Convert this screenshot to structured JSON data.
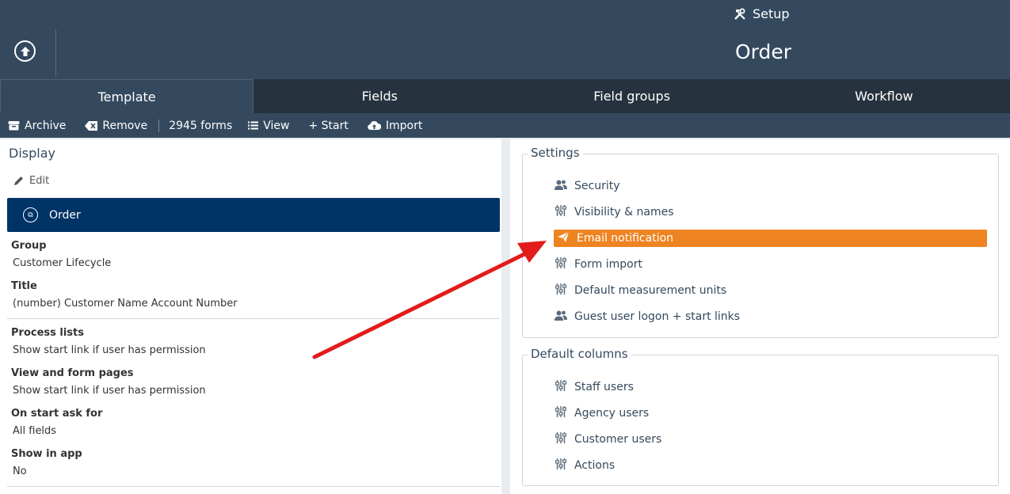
{
  "header": {
    "setup_label": "Setup",
    "page_title": "Order"
  },
  "tabs": [
    {
      "label": "Template"
    },
    {
      "label": "Fields"
    },
    {
      "label": "Field groups"
    },
    {
      "label": "Workflow"
    }
  ],
  "toolbar": {
    "archive": "Archive",
    "remove": "Remove",
    "forms_count": "2945 forms",
    "view": "View",
    "start": "+ Start",
    "import": "Import"
  },
  "display": {
    "title": "Display",
    "edit": "Edit",
    "selected": "Order",
    "fields": [
      {
        "label": "Group",
        "value": "Customer Lifecycle"
      },
      {
        "label": "Title",
        "value": "(number) Customer Name Account Number"
      },
      {
        "label": "Process lists",
        "value": "Show start link if user has permission"
      },
      {
        "label": "View and form pages",
        "value": "Show start link if user has permission"
      },
      {
        "label": "On start ask for",
        "value": "All fields"
      },
      {
        "label": "Show in app",
        "value": "No"
      }
    ]
  },
  "settings": {
    "title": "Settings",
    "items": [
      {
        "label": "Security",
        "icon": "users-icon"
      },
      {
        "label": "Visibility & names",
        "icon": "sliders-icon"
      },
      {
        "label": "Email notification",
        "icon": "paper-plane-icon",
        "highlighted": true
      },
      {
        "label": "Form import",
        "icon": "sliders-icon"
      },
      {
        "label": "Default measurement units",
        "icon": "sliders-icon"
      },
      {
        "label": "Guest user logon + start links",
        "icon": "users-icon"
      }
    ]
  },
  "default_columns": {
    "title": "Default columns",
    "items": [
      {
        "label": "Staff users",
        "icon": "sliders-icon"
      },
      {
        "label": "Agency users",
        "icon": "sliders-icon"
      },
      {
        "label": "Customer users",
        "icon": "sliders-icon"
      },
      {
        "label": "Actions",
        "icon": "sliders-icon"
      }
    ]
  },
  "colors": {
    "header_bg": "#34495e",
    "tabs_bg": "#26333f",
    "selected_bar": "#003366",
    "highlight": "#ee8421",
    "annotation_arrow": "#e31b1b"
  }
}
